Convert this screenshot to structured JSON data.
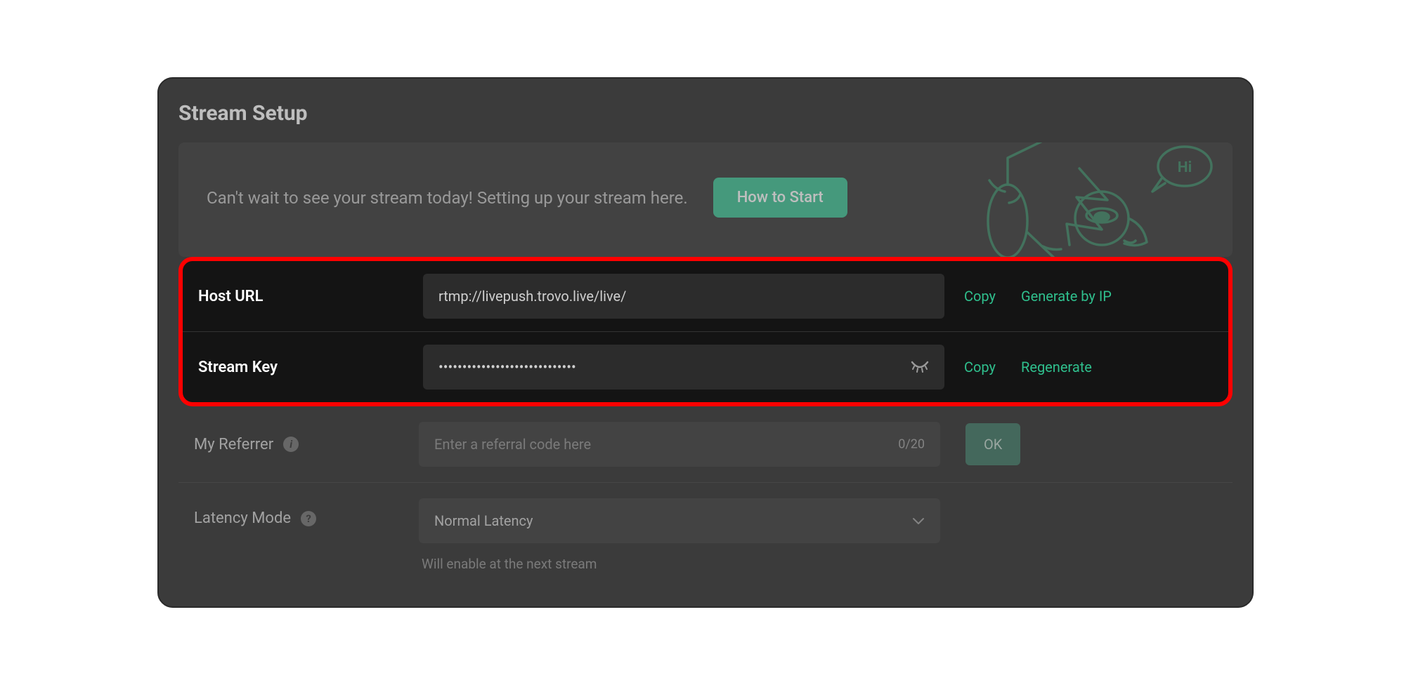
{
  "page": {
    "title": "Stream Setup"
  },
  "banner": {
    "text": "Can't wait to see your stream today! Setting up your stream here.",
    "how_to_start_label": "How to Start",
    "mascot_bubble": "Hi"
  },
  "host_url": {
    "label": "Host URL",
    "value": "rtmp://livepush.trovo.live/live/",
    "copy_label": "Copy",
    "generate_label": "Generate by IP"
  },
  "stream_key": {
    "label": "Stream Key",
    "masked_value": "•••••••••••••••••••••••••••••",
    "copy_label": "Copy",
    "regenerate_label": "Regenerate"
  },
  "referrer": {
    "label": "My Referrer",
    "placeholder": "Enter a referral code here",
    "char_count": "0/20",
    "ok_label": "OK"
  },
  "latency": {
    "label": "Latency Mode",
    "selected": "Normal Latency",
    "hint": "Will enable at the next stream"
  },
  "colors": {
    "accent": "#2fbf8d",
    "highlight_border": "#ff0000",
    "panel_bg": "#1e1e1e",
    "input_bg": "#2c2c2c"
  }
}
